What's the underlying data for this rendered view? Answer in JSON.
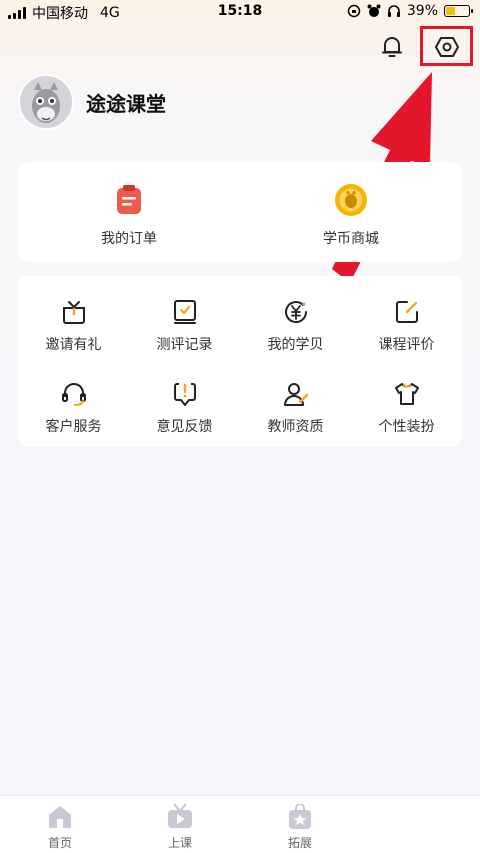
{
  "status_bar": {
    "carrier": "中国移动",
    "network": "4G",
    "time": "15:18",
    "battery": "39%",
    "battery_level": 0.39
  },
  "header": {
    "bell_icon": "bell-icon",
    "settings_icon": "settings-hexagon-icon"
  },
  "profile": {
    "name": "途途课堂",
    "avatar": "horse-avatar"
  },
  "quick_actions": [
    {
      "label": "我的订单",
      "icon": "order-clipboard-icon"
    },
    {
      "label": "学币商城",
      "icon": "coin-shop-icon"
    }
  ],
  "services": [
    {
      "label": "邀请有礼",
      "icon": "gift-icon"
    },
    {
      "label": "测评记录",
      "icon": "assessment-record-icon"
    },
    {
      "label": "我的学贝",
      "icon": "yuan-coin-icon"
    },
    {
      "label": "课程评价",
      "icon": "edit-review-icon"
    },
    {
      "label": "客户服务",
      "icon": "headset-icon"
    },
    {
      "label": "意见反馈",
      "icon": "feedback-icon"
    },
    {
      "label": "教师资质",
      "icon": "teacher-icon"
    },
    {
      "label": "个性装扮",
      "icon": "tshirt-icon"
    }
  ],
  "tabbar": [
    {
      "label": "首页",
      "icon": "home-icon"
    },
    {
      "label": "上课",
      "icon": "tv-play-icon"
    },
    {
      "label": "拓展",
      "icon": "star-bag-icon"
    }
  ],
  "colors": {
    "accent_orange": "#f5a623",
    "highlight_red": "#e4162b",
    "order_red": "#ef5b4b",
    "coin_gold": "#f4b400"
  }
}
